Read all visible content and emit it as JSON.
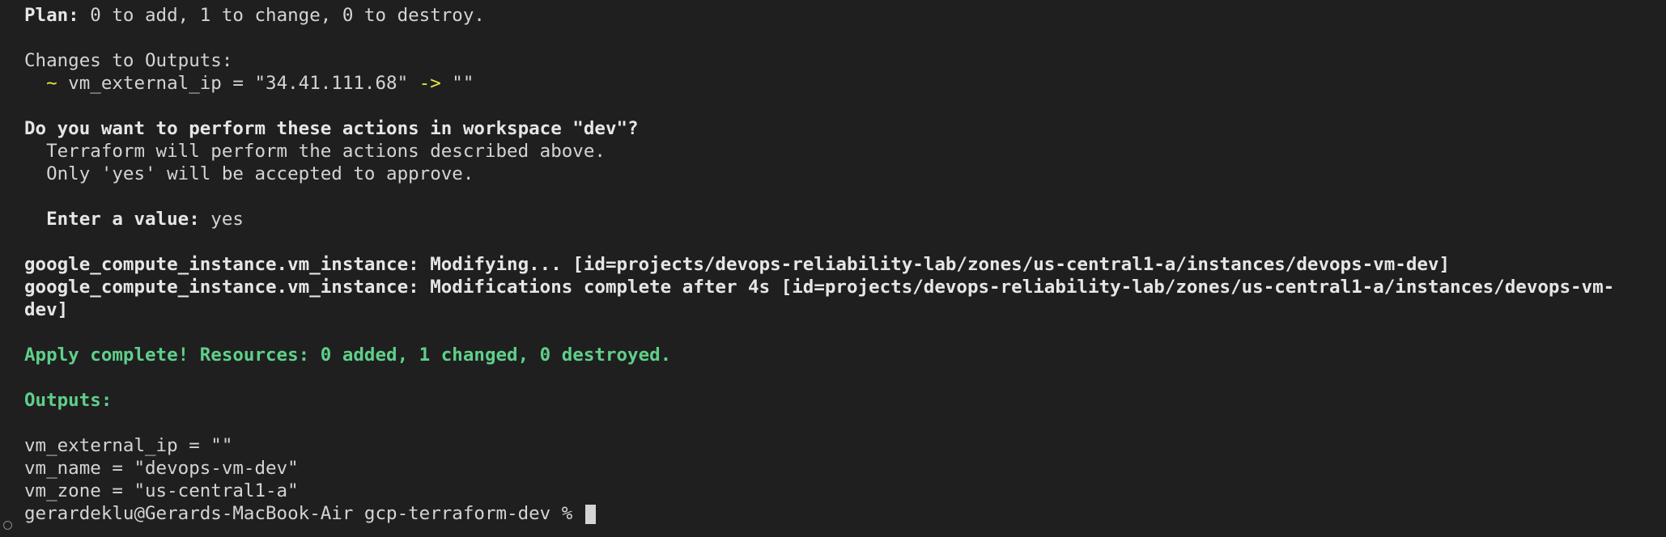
{
  "plan": {
    "label": "Plan:",
    "text": " 0 to add, 1 to change, 0 to destroy."
  },
  "changes": {
    "heading": "Changes to Outputs:",
    "indent": "  ",
    "tilde": "~",
    "lhs": " vm_external_ip = \"34.41.111.68\" ",
    "arrow": "->",
    "rhs": " \"\""
  },
  "confirm": {
    "question": "Do you want to perform these actions in workspace \"dev\"?",
    "line1": "  Terraform will perform the actions described above.",
    "line2": "  Only 'yes' will be accepted to approve.",
    "prompt_indent": "  ",
    "prompt_label": "Enter a value:",
    "prompt_value": " yes"
  },
  "progress": {
    "line1": "google_compute_instance.vm_instance: Modifying... [id=projects/devops-reliability-lab/zones/us-central1-a/instances/devops-vm-dev]",
    "line2": "google_compute_instance.vm_instance: Modifications complete after 4s [id=projects/devops-reliability-lab/zones/us-central1-a/instances/devops-vm-",
    "line3": "dev]"
  },
  "apply": {
    "message": "Apply complete! Resources: 0 added, 1 changed, 0 destroyed."
  },
  "outputs": {
    "heading": "Outputs:",
    "vm_external_ip": "vm_external_ip = \"\"",
    "vm_name": "vm_name = \"devops-vm-dev\"",
    "vm_zone": "vm_zone = \"us-central1-a\""
  },
  "shell": {
    "prompt": "gerardeklu@Gerards-MacBook-Air gcp-terraform-dev % "
  }
}
